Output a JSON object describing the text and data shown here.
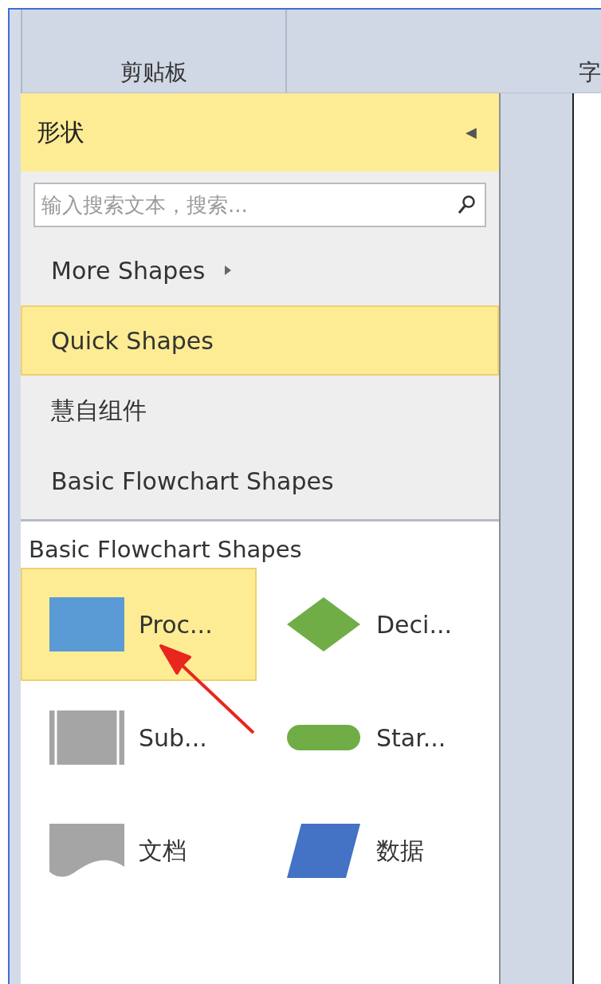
{
  "ribbon": {
    "groups": [
      "剪贴板",
      "字"
    ]
  },
  "panel": {
    "title": "形状",
    "collapse_glyph": "◀",
    "search": {
      "placeholder": "输入搜索文本，搜索..."
    },
    "menu": [
      {
        "label": "More Shapes",
        "submenu": true,
        "selected": false
      },
      {
        "label": "Quick Shapes",
        "submenu": false,
        "selected": true
      },
      {
        "label": "慧自组件",
        "submenu": false,
        "selected": false
      },
      {
        "label": "Basic Flowchart Shapes",
        "submenu": false,
        "selected": false
      }
    ],
    "library": {
      "title": "Basic Flowchart Shapes",
      "shapes": [
        {
          "kind": "process",
          "label": "Proc...",
          "selected": true
        },
        {
          "kind": "decision",
          "label": "Deci...",
          "selected": false
        },
        {
          "kind": "subprocess",
          "label": "Sub...",
          "selected": false
        },
        {
          "kind": "terminator",
          "label": "Star...",
          "selected": false
        },
        {
          "kind": "document",
          "label": "文档",
          "selected": false
        },
        {
          "kind": "data",
          "label": "数据",
          "selected": false
        }
      ]
    }
  }
}
